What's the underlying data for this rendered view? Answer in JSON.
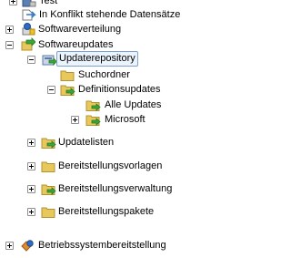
{
  "tree": {
    "items": [
      {
        "label": "Test",
        "icon": "sccm-computer-icon",
        "toggle": "plus"
      },
      {
        "label": "In Konflikt stehende Datensätze",
        "icon": "conflict-records-icon",
        "toggle": "none"
      },
      {
        "label": "Softwareverteilung",
        "icon": "software-distribution-icon",
        "toggle": "plus"
      },
      {
        "label": "Softwareupdates",
        "icon": "software-updates-icon",
        "toggle": "minus"
      },
      {
        "label": "Updaterepository",
        "icon": "update-repository-icon",
        "toggle": "minus",
        "selected": true
      },
      {
        "label": "Suchordner",
        "icon": "search-folder-icon",
        "toggle": "none"
      },
      {
        "label": "Definitionsupdates",
        "icon": "update-folder-icon",
        "toggle": "minus"
      },
      {
        "label": "Alle Updates",
        "icon": "update-folder-icon",
        "toggle": "none"
      },
      {
        "label": "Microsoft",
        "icon": "update-folder-icon",
        "toggle": "plus"
      },
      {
        "label": "Updatelisten",
        "icon": "update-folder-icon",
        "toggle": "plus"
      },
      {
        "label": "Bereitstellungsvorlagen",
        "icon": "folder-icon",
        "toggle": "plus"
      },
      {
        "label": "Bereitstellungsverwaltung",
        "icon": "update-folder-icon",
        "toggle": "plus"
      },
      {
        "label": "Bereitstellungspakete",
        "icon": "folder-icon",
        "toggle": "plus"
      },
      {
        "label": "Betriebssystembereitstellung",
        "icon": "os-deployment-icon",
        "toggle": "plus"
      }
    ]
  },
  "colors": {
    "folder": "#e8c85a",
    "arrow": "#3aa63a",
    "selection_border": "#7da2ce",
    "selection_fill": "#ebf4fd"
  }
}
